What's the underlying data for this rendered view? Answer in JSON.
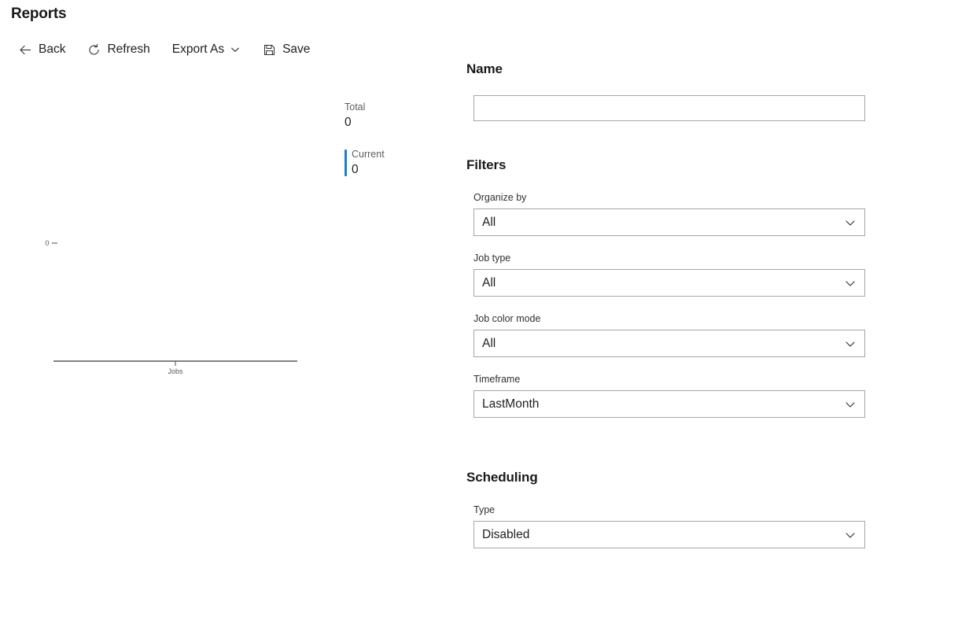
{
  "header": {
    "title": "Reports"
  },
  "toolbar": {
    "items": [
      {
        "label": "Back",
        "icon": "arrow-left-icon",
        "has_chevron": false
      },
      {
        "label": "Refresh",
        "icon": "refresh-icon",
        "has_chevron": false
      },
      {
        "label": "Export As",
        "icon": "none",
        "has_chevron": true
      },
      {
        "label": "Save",
        "icon": "save-icon",
        "has_chevron": false
      }
    ]
  },
  "stats": [
    {
      "label": "Total",
      "value": "0",
      "accent": false,
      "accent_color": ""
    },
    {
      "label": "Current",
      "value": "0",
      "accent": true,
      "accent_color": "#1a81c4"
    }
  ],
  "chart_data": {
    "type": "bar",
    "title": "",
    "subtitle": "",
    "categories": [
      "Jobs"
    ],
    "values": [
      0
    ],
    "series": [
      {
        "name": "Total",
        "values": [
          0
        ]
      },
      {
        "name": "Current",
        "values": [
          0
        ]
      }
    ],
    "xlabel": "",
    "ylabel": "",
    "xticklabels": [
      "Jobs"
    ],
    "yticklabels": [
      "0"
    ],
    "ylim": [
      0,
      0
    ],
    "grid": false,
    "legend": "none",
    "axis_color": "#595959",
    "tick_label_color": "#595959"
  },
  "form": {
    "name_section": {
      "heading": "Name",
      "input": {
        "value": "",
        "placeholder": ""
      }
    },
    "filters_section": {
      "heading": "Filters",
      "fields": [
        {
          "label": "Organize by",
          "value": "All"
        },
        {
          "label": "Job type",
          "value": "All"
        },
        {
          "label": "Job color mode",
          "value": "All"
        },
        {
          "label": "Timeframe",
          "value": "LastMonth"
        }
      ]
    },
    "scheduling_section": {
      "heading": "Scheduling",
      "fields": [
        {
          "label": "Type",
          "value": "Disabled"
        }
      ]
    }
  }
}
